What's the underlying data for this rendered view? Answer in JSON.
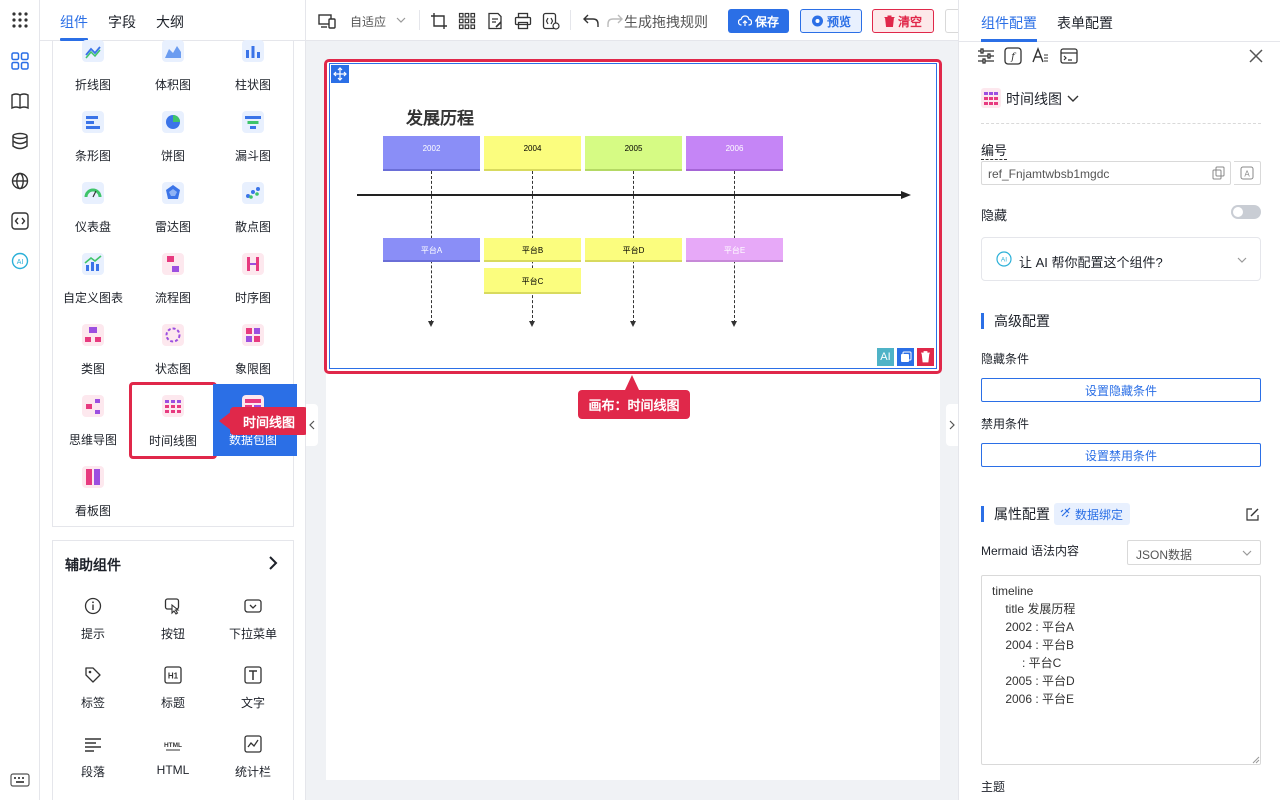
{
  "left_tabs": [
    "组件",
    "字段",
    "大纲"
  ],
  "chart_components": [
    {
      "label": "折线图",
      "icon": "line-chart-icon"
    },
    {
      "label": "体积图",
      "icon": "area-chart-icon"
    },
    {
      "label": "柱状图",
      "icon": "bar-chart-icon"
    },
    {
      "label": "条形图",
      "icon": "horizontal-bar-chart-icon"
    },
    {
      "label": "饼图",
      "icon": "pie-chart-icon"
    },
    {
      "label": "漏斗图",
      "icon": "funnel-chart-icon"
    },
    {
      "label": "仪表盘",
      "icon": "gauge-icon"
    },
    {
      "label": "雷达图",
      "icon": "radar-chart-icon"
    },
    {
      "label": "散点图",
      "icon": "scatter-chart-icon"
    },
    {
      "label": "自定义图表",
      "icon": "custom-chart-icon"
    },
    {
      "label": "流程图",
      "icon": "flowchart-icon"
    },
    {
      "label": "时序图",
      "icon": "sequence-diagram-icon"
    },
    {
      "label": "类图",
      "icon": "class-diagram-icon"
    },
    {
      "label": "状态图",
      "icon": "state-diagram-icon"
    },
    {
      "label": "象限图",
      "icon": "quadrant-chart-icon"
    },
    {
      "label": "思维导图",
      "icon": "mindmap-icon"
    },
    {
      "label": "时间线图",
      "icon": "timeline-icon"
    },
    {
      "label": "数据包图",
      "icon": "packet-chart-icon"
    },
    {
      "label": "看板图",
      "icon": "kanban-icon"
    }
  ],
  "aux_title": "辅助组件",
  "aux_components": [
    {
      "label": "提示",
      "icon": "info-icon"
    },
    {
      "label": "按钮",
      "icon": "button-icon"
    },
    {
      "label": "下拉菜单",
      "icon": "dropdown-icon"
    },
    {
      "label": "标签",
      "icon": "tag-icon"
    },
    {
      "label": "标题",
      "icon": "heading-icon"
    },
    {
      "label": "文字",
      "icon": "text-icon"
    },
    {
      "label": "段落",
      "icon": "paragraph-icon"
    },
    {
      "label": "HTML",
      "icon": "html-icon"
    },
    {
      "label": "统计栏",
      "icon": "statistic-icon"
    }
  ],
  "drag_callout": "时间线图",
  "canvas_callout": "画布：时间线图",
  "toolbar": {
    "zoom": "自适应",
    "generate_rule": "生成拖拽规则",
    "save": "保存",
    "preview": "预览",
    "clear": "清空"
  },
  "timeline": {
    "title": "发展历程",
    "years": [
      "2002",
      "2004",
      "2005",
      "2006"
    ],
    "events": [
      "平台A",
      "平台B",
      "平台C",
      "平台D",
      "平台E"
    ],
    "colors": {
      "2002": "#8a8ef7",
      "2004": "#fbfd7e",
      "2005": "#d6fb84",
      "2006": "#c585f6",
      "platE": "#e7a9f8"
    }
  },
  "right_tabs": [
    "组件配置",
    "表单配置"
  ],
  "component_name": "时间线图",
  "fields": {
    "id_label": "编号",
    "id_value": "ref_Fnjamtwbsb1mgdc",
    "hidden_label": "隐藏",
    "ai_prompt": "让 AI 帮你配置这个组件?",
    "advanced_title": "高级配置",
    "hide_cond_label": "隐藏条件",
    "hide_cond_button": "设置隐藏条件",
    "disable_cond_label": "禁用条件",
    "disable_cond_button": "设置禁用条件",
    "props_title": "属性配置",
    "data_binding": "数据绑定",
    "mermaid_label": "Mermaid 语法内容",
    "format_select": "JSON数据",
    "theme_label": "主题"
  },
  "code_lines": [
    "timeline",
    "    title 发展历程",
    "    2002 : 平台A",
    "    2004 : 平台B",
    "         : 平台C",
    "    2005 : 平台D",
    "    2006 : 平台E"
  ],
  "accent_color": "#2b6fe6",
  "highlight_color": "#e0284a"
}
